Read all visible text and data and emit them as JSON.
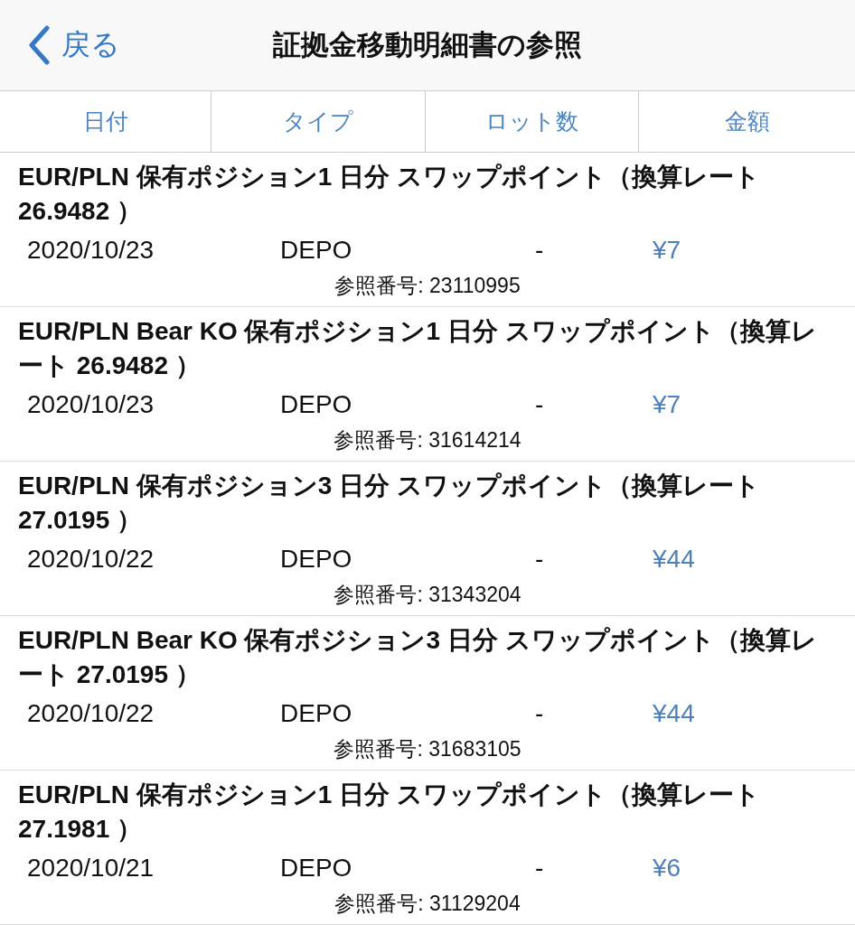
{
  "nav": {
    "back": "戻る",
    "title": "証拠金移動明細書の参照"
  },
  "columns": [
    "日付",
    "タイプ",
    "ロット数",
    "金額"
  ],
  "entries": [
    {
      "title": "EUR/PLN 保有ポジション1 日分 スワップポイント（換算レート 26.9482 ）",
      "date": "2020/10/23",
      "type": "DEPO",
      "lots": "-",
      "amount": "¥7",
      "ref_label": "参照番号:",
      "ref": "23110995"
    },
    {
      "title": "EUR/PLN Bear KO 保有ポジション1 日分 スワップポイント（換算レート 26.9482 ）",
      "date": "2020/10/23",
      "type": "DEPO",
      "lots": "-",
      "amount": "¥7",
      "ref_label": "参照番号:",
      "ref": "31614214"
    },
    {
      "title": "EUR/PLN 保有ポジション3 日分 スワップポイント（換算レート 27.0195 ）",
      "date": "2020/10/22",
      "type": "DEPO",
      "lots": "-",
      "amount": "¥44",
      "ref_label": "参照番号:",
      "ref": "31343204"
    },
    {
      "title": "EUR/PLN Bear KO 保有ポジション3 日分 スワップポイント（換算レート 27.0195 ）",
      "date": "2020/10/22",
      "type": "DEPO",
      "lots": "-",
      "amount": "¥44",
      "ref_label": "参照番号:",
      "ref": "31683105"
    },
    {
      "title": "EUR/PLN 保有ポジション1 日分 スワップポイント（換算レート 27.1981 ）",
      "date": "2020/10/21",
      "type": "DEPO",
      "lots": "-",
      "amount": "¥6",
      "ref_label": "参照番号:",
      "ref": "31129204"
    }
  ]
}
